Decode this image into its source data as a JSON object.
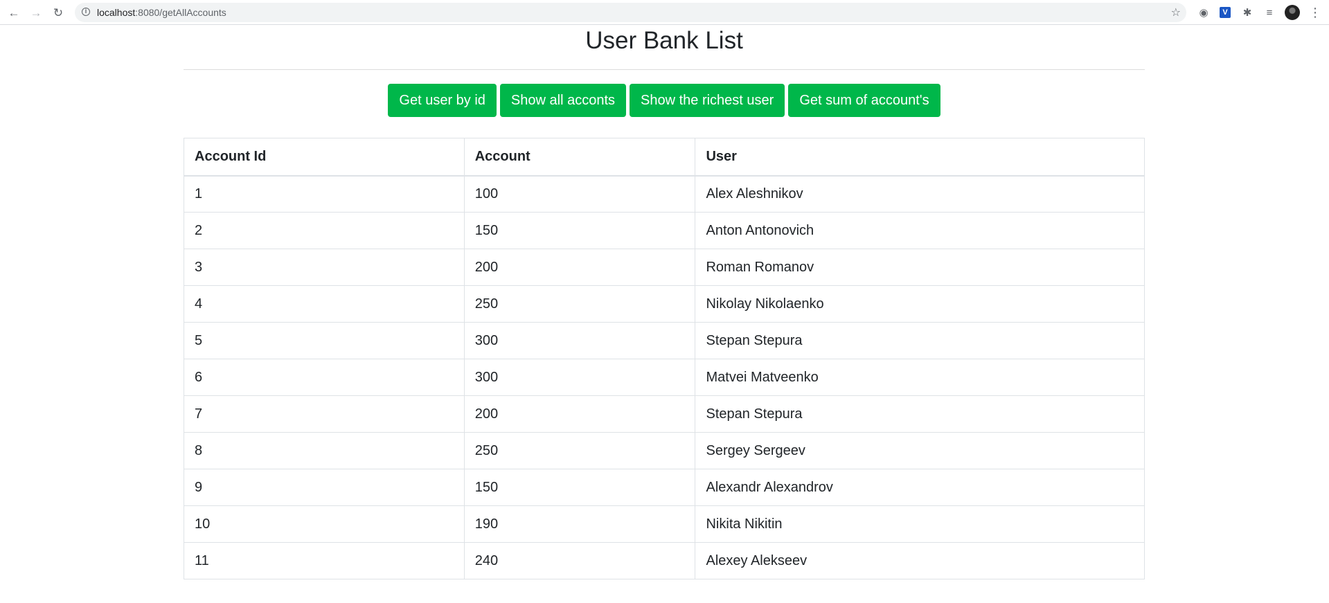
{
  "browser": {
    "url_host": "localhost",
    "url_rest": ":8080/getAllAccounts",
    "icons": [
      "back-arrow-icon",
      "forward-arrow-icon",
      "reload-icon",
      "info-icon",
      "star-icon",
      "globe-icon",
      "extension-icon",
      "puzzle-icon",
      "reading-list-icon",
      "profile-avatar",
      "more-menu-icon"
    ]
  },
  "page": {
    "title": "User Bank List"
  },
  "actions": {
    "get_user_by_id": "Get user by id",
    "show_all_accounts": "Show all acconts",
    "show_richest_user": "Show the richest user",
    "get_sum": "Get sum of account's"
  },
  "table": {
    "headers": [
      "Account Id",
      "Account",
      "User"
    ],
    "rows": [
      [
        "1",
        "100",
        "Alex Aleshnikov"
      ],
      [
        "2",
        "150",
        "Anton Antonovich"
      ],
      [
        "3",
        "200",
        "Roman Romanov"
      ],
      [
        "4",
        "250",
        "Nikolay Nikolaenko"
      ],
      [
        "5",
        "300",
        "Stepan Stepura"
      ],
      [
        "6",
        "300",
        "Matvei Matveenko"
      ],
      [
        "7",
        "200",
        "Stepan Stepura"
      ],
      [
        "8",
        "250",
        "Sergey Sergeev"
      ],
      [
        "9",
        "150",
        "Alexandr Alexandrov"
      ],
      [
        "10",
        "190",
        "Nikita Nikitin"
      ],
      [
        "11",
        "240",
        "Alexey Alekseev"
      ]
    ]
  },
  "colors": {
    "button_bg": "#00b74a",
    "button_text": "#ffffff",
    "table_border": "#dee2e6"
  }
}
